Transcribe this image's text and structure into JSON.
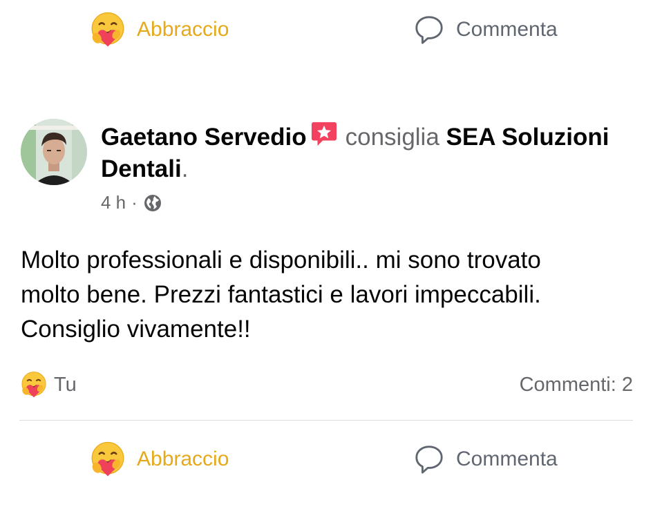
{
  "top_actions": {
    "react_label": "Abbraccio",
    "comment_label": "Commenta",
    "react_icon": "hug-reaction-icon",
    "comment_icon": "comment-bubble-icon"
  },
  "post": {
    "author": "Gaetano Servedio",
    "verb": "consiglia",
    "page": "SEA Soluzioni Dentali",
    "period": ".",
    "time": "4 h",
    "separator": "·",
    "audience_icon": "globe-icon",
    "recommend_badge_icon": "recommend-star-icon",
    "body_lines": [
      "Molto professionali e disponibili.. mi sono trovato",
      "molto bene. Prezzi fantastici e lavori impeccabili.",
      "Consiglio vivamente!!"
    ],
    "reaction_by": "Tu",
    "comments_count_text": "Commenti: 2"
  },
  "bottom_actions": {
    "react_label": "Abbraccio",
    "comment_label": "Commenta"
  },
  "colors": {
    "react_accent": "#e6a919",
    "secondary_text": "#65676b",
    "recommend_badge": "#f3425f",
    "divider": "#dadde1"
  }
}
